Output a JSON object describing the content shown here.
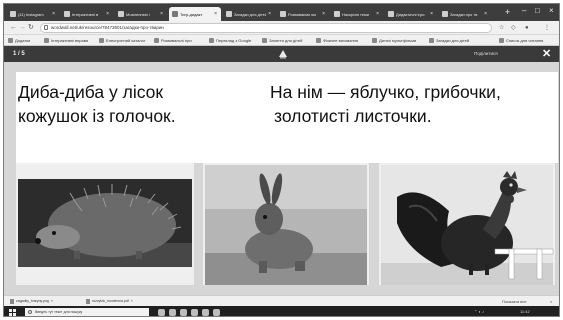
{
  "browser": {
    "tabs": [
      {
        "label": "(11) Instagram"
      },
      {
        "label": "Інтерактивні в"
      },
      {
        "label": "Мовленнєві і"
      },
      {
        "label": "Тигр-дидакт"
      },
      {
        "label": "Загадки для дітей"
      },
      {
        "label": "Розвиваємо мо"
      },
      {
        "label": "Наскрізні теми"
      },
      {
        "label": "Дидактичні ігри"
      },
      {
        "label": "Загадки про тв"
      }
    ],
    "address": "wordwall.net/uk/resource/78473501/загадки-про-тварин",
    "bookmarks": [
      {
        "label": "Додатки"
      },
      {
        "label": "Інтерактивні вправи"
      },
      {
        "label": "Електронний каталог"
      },
      {
        "label": "Розвивальні ігри"
      },
      {
        "label": "Переклад з Google"
      },
      {
        "label": "Заняття для дітей"
      },
      {
        "label": "Фізичне виховання"
      },
      {
        "label": "Дитячі мультфільми"
      },
      {
        "label": "Загадки для дітей"
      },
      {
        "label": "Список для читання"
      }
    ]
  },
  "presentation": {
    "page": "1 / 5",
    "share_label": "Поділитися",
    "close_label": "✕"
  },
  "riddle": {
    "left_line1": "Диба-диба у лісок",
    "left_line2": "кожушок із голочок.",
    "right_line1": "На нім — яблучко, грибочки,",
    "right_line2": "золотисті листочки."
  },
  "images": [
    {
      "name": "hedgehog"
    },
    {
      "name": "hare"
    },
    {
      "name": "rooster"
    }
  ],
  "downloads": [
    {
      "label": "zagadky_tvaryny.png"
    },
    {
      "label": "rozvytok_movlennia.pdf"
    }
  ],
  "downloads_show_all": "Показати все",
  "taskbar": {
    "search_placeholder": "Введіть тут текст для пошуку",
    "clock": "11:42"
  }
}
